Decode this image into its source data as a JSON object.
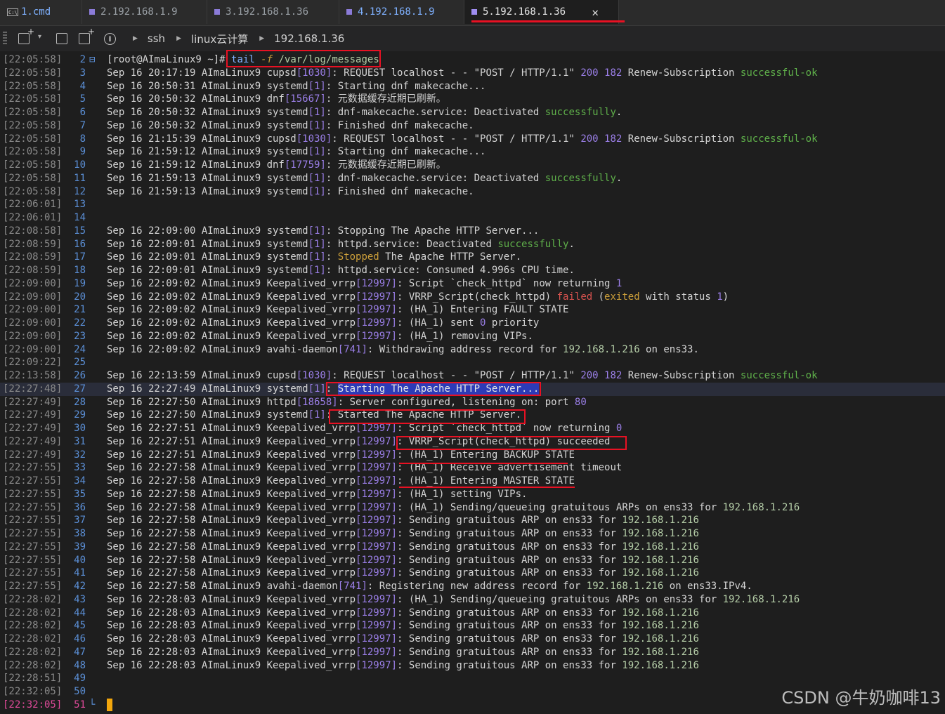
{
  "tabs": [
    {
      "label": "1.cmd",
      "type": "cmd"
    },
    {
      "label": "2.192.168.1.9",
      "type": "ssh"
    },
    {
      "label": "3.192.168.1.36",
      "type": "ssh"
    },
    {
      "label": "4.192.168.1.9",
      "type": "ssh"
    },
    {
      "label": "5.192.168.1.36",
      "type": "ssh",
      "active": true
    }
  ],
  "toolbar": {
    "breadcrumbs": [
      "ssh",
      "linux云计算",
      "192.168.1.36"
    ],
    "icons": [
      "new-tab-icon",
      "duplicate-tab-icon",
      "new-window-icon",
      "info-icon"
    ]
  },
  "watermark": "CSDN @牛奶咖啡13",
  "colors": {
    "accent_red": "#e81123",
    "success_green": "#5fb04a",
    "pid_purple": "#9b7fe8",
    "ip_green": "#b5cea8",
    "cursor": "#f2a60c"
  },
  "lines": [
    {
      "ts": "[22:05:58]",
      "n": "2",
      "prompt": "[root@AImaLinux9 ~]#",
      "cmd": "tail -f /var/log/messages"
    },
    {
      "ts": "[22:05:58]",
      "n": "3",
      "t": "Sep 16 20:17:19 AImaLinux9 cupsd[1030]: REQUEST localhost - - \"POST / HTTP/1.1\" 200 182 Renew-Subscription successful-ok"
    },
    {
      "ts": "[22:05:58]",
      "n": "4",
      "t": "Sep 16 20:50:31 AImaLinux9 systemd[1]: Starting dnf makecache..."
    },
    {
      "ts": "[22:05:58]",
      "n": "5",
      "t": "Sep 16 20:50:32 AImaLinux9 dnf[15667]: 元数据缓存近期已刷新。"
    },
    {
      "ts": "[22:05:58]",
      "n": "6",
      "t": "Sep 16 20:50:32 AImaLinux9 systemd[1]: dnf-makecache.service: Deactivated successfully."
    },
    {
      "ts": "[22:05:58]",
      "n": "7",
      "t": "Sep 16 20:50:32 AImaLinux9 systemd[1]: Finished dnf makecache."
    },
    {
      "ts": "[22:05:58]",
      "n": "8",
      "t": "Sep 16 21:15:39 AImaLinux9 cupsd[1030]: REQUEST localhost - - \"POST / HTTP/1.1\" 200 182 Renew-Subscription successful-ok"
    },
    {
      "ts": "[22:05:58]",
      "n": "9",
      "t": "Sep 16 21:59:12 AImaLinux9 systemd[1]: Starting dnf makecache..."
    },
    {
      "ts": "[22:05:58]",
      "n": "10",
      "t": "Sep 16 21:59:12 AImaLinux9 dnf[17759]: 元数据缓存近期已刷新。"
    },
    {
      "ts": "[22:05:58]",
      "n": "11",
      "t": "Sep 16 21:59:13 AImaLinux9 systemd[1]: dnf-makecache.service: Deactivated successfully."
    },
    {
      "ts": "[22:05:58]",
      "n": "12",
      "t": "Sep 16 21:59:13 AImaLinux9 systemd[1]: Finished dnf makecache."
    },
    {
      "ts": "[22:06:01]",
      "n": "13",
      "t": ""
    },
    {
      "ts": "[22:06:01]",
      "n": "14",
      "t": ""
    },
    {
      "ts": "[22:08:58]",
      "n": "15",
      "t": "Sep 16 22:09:00 AImaLinux9 systemd[1]: Stopping The Apache HTTP Server..."
    },
    {
      "ts": "[22:08:59]",
      "n": "16",
      "t": "Sep 16 22:09:01 AImaLinux9 systemd[1]: httpd.service: Deactivated successfully."
    },
    {
      "ts": "[22:08:59]",
      "n": "17",
      "t": "Sep 16 22:09:01 AImaLinux9 systemd[1]: Stopped The Apache HTTP Server."
    },
    {
      "ts": "[22:08:59]",
      "n": "18",
      "t": "Sep 16 22:09:01 AImaLinux9 systemd[1]: httpd.service: Consumed 4.996s CPU time."
    },
    {
      "ts": "[22:09:00]",
      "n": "19",
      "t": "Sep 16 22:09:02 AImaLinux9 Keepalived_vrrp[12997]: Script `check_httpd` now returning 1"
    },
    {
      "ts": "[22:09:00]",
      "n": "20",
      "t": "Sep 16 22:09:02 AImaLinux9 Keepalived_vrrp[12997]: VRRP_Script(check_httpd) failed (exited with status 1)"
    },
    {
      "ts": "[22:09:00]",
      "n": "21",
      "t": "Sep 16 22:09:02 AImaLinux9 Keepalived_vrrp[12997]: (HA_1) Entering FAULT STATE"
    },
    {
      "ts": "[22:09:00]",
      "n": "22",
      "t": "Sep 16 22:09:02 AImaLinux9 Keepalived_vrrp[12997]: (HA_1) sent 0 priority"
    },
    {
      "ts": "[22:09:00]",
      "n": "23",
      "t": "Sep 16 22:09:02 AImaLinux9 Keepalived_vrrp[12997]: (HA_1) removing VIPs."
    },
    {
      "ts": "[22:09:00]",
      "n": "24",
      "t": "Sep 16 22:09:02 AImaLinux9 avahi-daemon[741]: Withdrawing address record for 192.168.1.216 on ens33."
    },
    {
      "ts": "[22:09:22]",
      "n": "25",
      "t": ""
    },
    {
      "ts": "[22:13:58]",
      "n": "26",
      "t": "Sep 16 22:13:59 AImaLinux9 cupsd[1030]: REQUEST localhost - - \"POST / HTTP/1.1\" 200 182 Renew-Subscription successful-ok"
    },
    {
      "ts": "[22:27:48]",
      "n": "27",
      "t": "Sep 16 22:27:49 AImaLinux9 systemd[1]: Starting The Apache HTTP Server...",
      "hl": true
    },
    {
      "ts": "[22:27:49]",
      "n": "28",
      "t": "Sep 16 22:27:50 AImaLinux9 httpd[18658]: Server configured, listening on: port 80"
    },
    {
      "ts": "[22:27:49]",
      "n": "29",
      "t": "Sep 16 22:27:50 AImaLinux9 systemd[1]: Started The Apache HTTP Server."
    },
    {
      "ts": "[22:27:49]",
      "n": "30",
      "t": "Sep 16 22:27:51 AImaLinux9 Keepalived_vrrp[12997]: Script `check_httpd` now returning 0"
    },
    {
      "ts": "[22:27:49]",
      "n": "31",
      "t": "Sep 16 22:27:51 AImaLinux9 Keepalived_vrrp[12997]: VRRP_Script(check_httpd) succeeded"
    },
    {
      "ts": "[22:27:49]",
      "n": "32",
      "t": "Sep 16 22:27:51 AImaLinux9 Keepalived_vrrp[12997]: (HA_1) Entering BACKUP STATE"
    },
    {
      "ts": "[22:27:55]",
      "n": "33",
      "t": "Sep 16 22:27:58 AImaLinux9 Keepalived_vrrp[12997]: (HA_1) Receive advertisement timeout"
    },
    {
      "ts": "[22:27:55]",
      "n": "34",
      "t": "Sep 16 22:27:58 AImaLinux9 Keepalived_vrrp[12997]: (HA_1) Entering MASTER STATE"
    },
    {
      "ts": "[22:27:55]",
      "n": "35",
      "t": "Sep 16 22:27:58 AImaLinux9 Keepalived_vrrp[12997]: (HA_1) setting VIPs."
    },
    {
      "ts": "[22:27:55]",
      "n": "36",
      "t": "Sep 16 22:27:58 AImaLinux9 Keepalived_vrrp[12997]: (HA_1) Sending/queueing gratuitous ARPs on ens33 for 192.168.1.216"
    },
    {
      "ts": "[22:27:55]",
      "n": "37",
      "t": "Sep 16 22:27:58 AImaLinux9 Keepalived_vrrp[12997]: Sending gratuitous ARP on ens33 for 192.168.1.216"
    },
    {
      "ts": "[22:27:55]",
      "n": "38",
      "t": "Sep 16 22:27:58 AImaLinux9 Keepalived_vrrp[12997]: Sending gratuitous ARP on ens33 for 192.168.1.216"
    },
    {
      "ts": "[22:27:55]",
      "n": "39",
      "t": "Sep 16 22:27:58 AImaLinux9 Keepalived_vrrp[12997]: Sending gratuitous ARP on ens33 for 192.168.1.216"
    },
    {
      "ts": "[22:27:55]",
      "n": "40",
      "t": "Sep 16 22:27:58 AImaLinux9 Keepalived_vrrp[12997]: Sending gratuitous ARP on ens33 for 192.168.1.216"
    },
    {
      "ts": "[22:27:55]",
      "n": "41",
      "t": "Sep 16 22:27:58 AImaLinux9 Keepalived_vrrp[12997]: Sending gratuitous ARP on ens33 for 192.168.1.216"
    },
    {
      "ts": "[22:27:55]",
      "n": "42",
      "t": "Sep 16 22:27:58 AImaLinux9 avahi-daemon[741]: Registering new address record for 192.168.1.216 on ens33.IPv4."
    },
    {
      "ts": "[22:28:02]",
      "n": "43",
      "t": "Sep 16 22:28:03 AImaLinux9 Keepalived_vrrp[12997]: (HA_1) Sending/queueing gratuitous ARPs on ens33 for 192.168.1.216"
    },
    {
      "ts": "[22:28:02]",
      "n": "44",
      "t": "Sep 16 22:28:03 AImaLinux9 Keepalived_vrrp[12997]: Sending gratuitous ARP on ens33 for 192.168.1.216"
    },
    {
      "ts": "[22:28:02]",
      "n": "45",
      "t": "Sep 16 22:28:03 AImaLinux9 Keepalived_vrrp[12997]: Sending gratuitous ARP on ens33 for 192.168.1.216"
    },
    {
      "ts": "[22:28:02]",
      "n": "46",
      "t": "Sep 16 22:28:03 AImaLinux9 Keepalived_vrrp[12997]: Sending gratuitous ARP on ens33 for 192.168.1.216"
    },
    {
      "ts": "[22:28:02]",
      "n": "47",
      "t": "Sep 16 22:28:03 AImaLinux9 Keepalived_vrrp[12997]: Sending gratuitous ARP on ens33 for 192.168.1.216"
    },
    {
      "ts": "[22:28:02]",
      "n": "48",
      "t": "Sep 16 22:28:03 AImaLinux9 Keepalived_vrrp[12997]: Sending gratuitous ARP on ens33 for 192.168.1.216"
    },
    {
      "ts": "[22:28:51]",
      "n": "49",
      "t": ""
    },
    {
      "ts": "[22:32:05]",
      "n": "50",
      "t": ""
    },
    {
      "ts": "[22:32:05]",
      "n": "51",
      "t": "",
      "cursor": true
    }
  ]
}
